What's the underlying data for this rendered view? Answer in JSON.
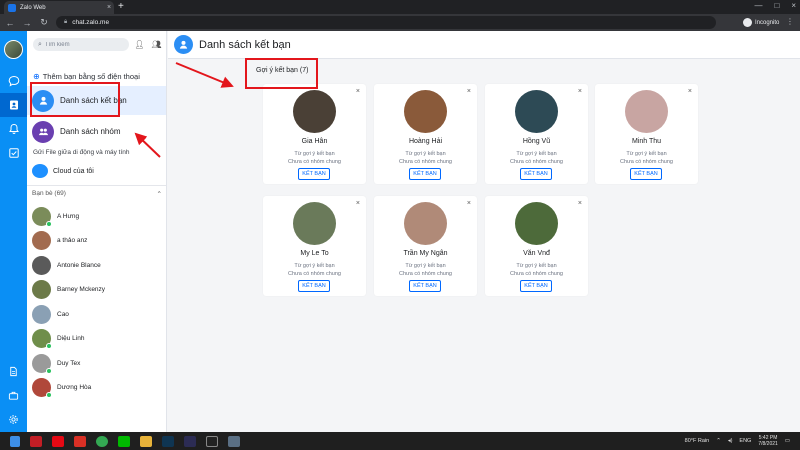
{
  "browser": {
    "tab_title": "Zalo Web",
    "tab_close": "×",
    "new_tab": "+",
    "url": "chat.zalo.me",
    "profile": "Incognito",
    "window_controls": [
      "—",
      "□",
      "×"
    ]
  },
  "sidebar": {
    "search_placeholder": "Tìm kiếm",
    "add_by_phone": "Thêm bạn bằng số điện thoại",
    "menu": [
      {
        "label": "Danh sách kết bạn",
        "active": true
      },
      {
        "label": "Danh sách nhóm",
        "active": false
      }
    ],
    "file_transfer_label": "Gửi File giữa di động và máy tính",
    "cloud_label": "Cloud của tôi",
    "friends_header": "Bạn bè (69)",
    "friends": [
      {
        "name": "A Hưng",
        "online": true,
        "color": "#7b8c5a"
      },
      {
        "name": "a thảo anz",
        "online": false,
        "color": "#a26b4f"
      },
      {
        "name": "Antonie Blance",
        "online": false,
        "color": "#5a5a5a"
      },
      {
        "name": "Barney Mckenzy",
        "online": false,
        "color": "#6c7a48"
      },
      {
        "name": "Cao",
        "online": false,
        "color": "#8aa0b4"
      },
      {
        "name": "Diệu Linh",
        "online": true,
        "color": "#6f8e4a"
      },
      {
        "name": "Duy Tex",
        "online": true,
        "color": "#9a9a9a"
      },
      {
        "name": "Dương Hòa",
        "online": true,
        "color": "#b0483a"
      }
    ]
  },
  "main": {
    "title": "Danh sách kết bạn",
    "suggest_label": "Gợi ý kết bạn (7)",
    "cards": [
      {
        "name": "Gia Hân",
        "line1": "Từ gợi ý kết bạn",
        "line2": "Chưa có nhóm chung",
        "button": "KẾT BẠN",
        "close": "×",
        "color": "#4a4036"
      },
      {
        "name": "Hoàng Hải",
        "line1": "Từ gợi ý kết bạn",
        "line2": "Chưa có nhóm chung",
        "button": "KẾT BẠN",
        "close": "×",
        "color": "#8a5a3a"
      },
      {
        "name": "Hồng Vũ",
        "line1": "Từ gợi ý kết bạn",
        "line2": "Chưa có nhóm chung",
        "button": "KẾT BẠN",
        "close": "×",
        "color": "#2d4a55"
      },
      {
        "name": "Minh Thu",
        "line1": "Từ gợi ý kết bạn",
        "line2": "Chưa có nhóm chung",
        "button": "KẾT BẠN",
        "close": "×",
        "color": "#c8a5a2"
      },
      {
        "name": "My Le To",
        "line1": "Từ gợi ý kết bạn",
        "line2": "Chưa có nhóm chung",
        "button": "KẾT BẠN",
        "close": "×",
        "color": "#6a7a5a"
      },
      {
        "name": "Trần My Ngân",
        "line1": "Từ gợi ý kết bạn",
        "line2": "Chưa có nhóm chung",
        "button": "KẾT BẠN",
        "close": "×",
        "color": "#b08a78"
      },
      {
        "name": "Văn Vnđ",
        "line1": "Từ gợi ý kết bạn",
        "line2": "Chưa có nhóm chung",
        "button": "KẾT BẠN",
        "close": "×",
        "color": "#4d6a3a"
      }
    ]
  },
  "taskbar": {
    "weather": "80°F Rain",
    "language": "ENG",
    "time": "5:42 PM",
    "date": "7/8/2021"
  },
  "colors": {
    "rail": "#0a8ff5",
    "accent": "#0068ff",
    "annotation": "#e3161c"
  }
}
